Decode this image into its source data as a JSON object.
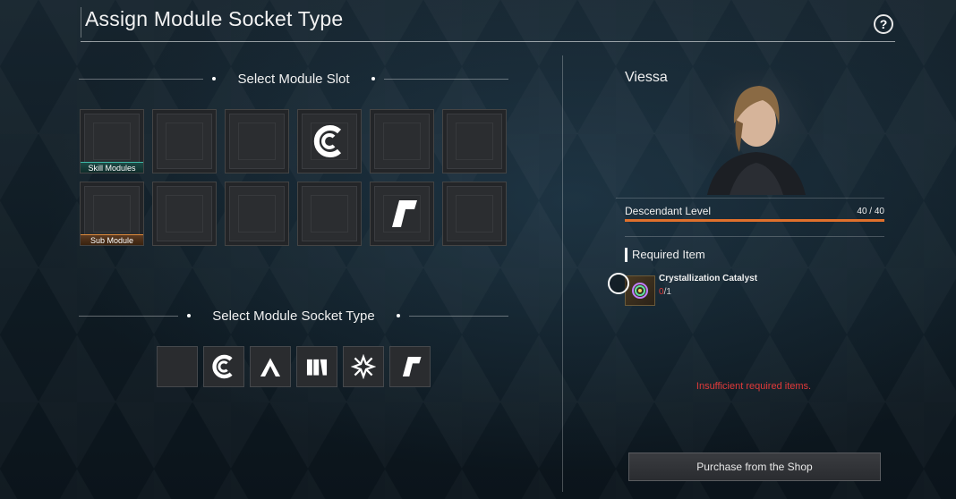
{
  "header": {
    "title": "Assign Module Socket Type",
    "help_label": "?"
  },
  "slots_section": {
    "title": "Select Module Slot",
    "row1": [
      {
        "tag": "Skill Modules",
        "symbol": ""
      },
      {
        "tag": "",
        "symbol": ""
      },
      {
        "tag": "",
        "symbol": ""
      },
      {
        "tag": "",
        "symbol": "cerulean-socket-icon"
      },
      {
        "tag": "",
        "symbol": ""
      },
      {
        "tag": "",
        "symbol": ""
      }
    ],
    "row2": [
      {
        "tag": "Sub Module",
        "symbol": ""
      },
      {
        "tag": "",
        "symbol": ""
      },
      {
        "tag": "",
        "symbol": ""
      },
      {
        "tag": "",
        "symbol": ""
      },
      {
        "tag": "",
        "symbol": "rutile-socket-icon"
      },
      {
        "tag": "",
        "symbol": ""
      }
    ]
  },
  "socket_section": {
    "title": "Select Module Socket Type",
    "types": [
      "none",
      "cerulean-socket-icon",
      "almandine-socket-icon",
      "malachite-socket-icon",
      "xantic-socket-icon",
      "rutile-socket-icon"
    ]
  },
  "character": {
    "name": "Viessa",
    "level_label": "Descendant Level",
    "level_value": "40 / 40",
    "level_progress": 1.0
  },
  "required": {
    "title": "Required Item",
    "item_name": "Crystallization Catalyst",
    "have": "0",
    "need": "/1",
    "warning": "Insufficient required items."
  },
  "actions": {
    "purchase_label": "Purchase from the Shop"
  },
  "colors": {
    "skill_accent": "#3fb9a8",
    "sub_accent": "#e08a3a",
    "level_bar": "#e0702c",
    "warning": "#e23a3a"
  }
}
